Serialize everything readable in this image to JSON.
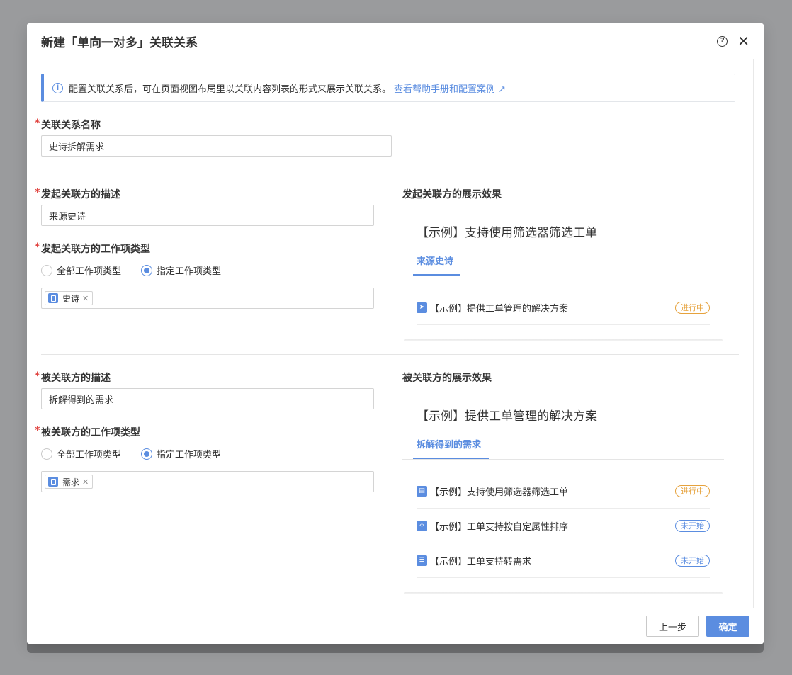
{
  "dialog": {
    "title": "新建「单向一对多」关联关系"
  },
  "info": {
    "text": "配置关联关系后，可在页面视图布局里以关联内容列表的形式来展示关联关系。",
    "link": "查看帮助手册和配置案例 ↗"
  },
  "relation_name": {
    "label": "关联关系名称",
    "value": "史诗拆解需求"
  },
  "source": {
    "desc_label": "发起关联方的描述",
    "desc_value": "来源史诗",
    "type_label": "发起关联方的工作项类型",
    "radio_all": "全部工作项类型",
    "radio_specific": "指定工作项类型",
    "tag": "史诗",
    "preview_label": "发起关联方的展示效果",
    "preview_title": "【示例】支持使用筛选器筛选工单",
    "preview_tab": "来源史诗",
    "items": [
      {
        "text": "【示例】提供工单管理的解决方案",
        "status": "进行中"
      }
    ]
  },
  "target": {
    "desc_label": "被关联方的描述",
    "desc_value": "拆解得到的需求",
    "type_label": "被关联方的工作项类型",
    "radio_all": "全部工作项类型",
    "radio_specific": "指定工作项类型",
    "tag": "需求",
    "preview_label": "被关联方的展示效果",
    "preview_title": "【示例】提供工单管理的解决方案",
    "preview_tab": "拆解得到的需求",
    "items": [
      {
        "text": "【示例】支持使用筛选器筛选工单",
        "status": "进行中"
      },
      {
        "text": "【示例】工单支持按自定属性排序",
        "status": "未开始"
      },
      {
        "text": "【示例】工单支持转需求",
        "status": "未开始"
      }
    ]
  },
  "footer": {
    "prev": "上一步",
    "confirm": "确定"
  },
  "colors": {
    "accent": "#5b8de0",
    "required": "#e0413d",
    "in_progress": "#e6a23c"
  }
}
